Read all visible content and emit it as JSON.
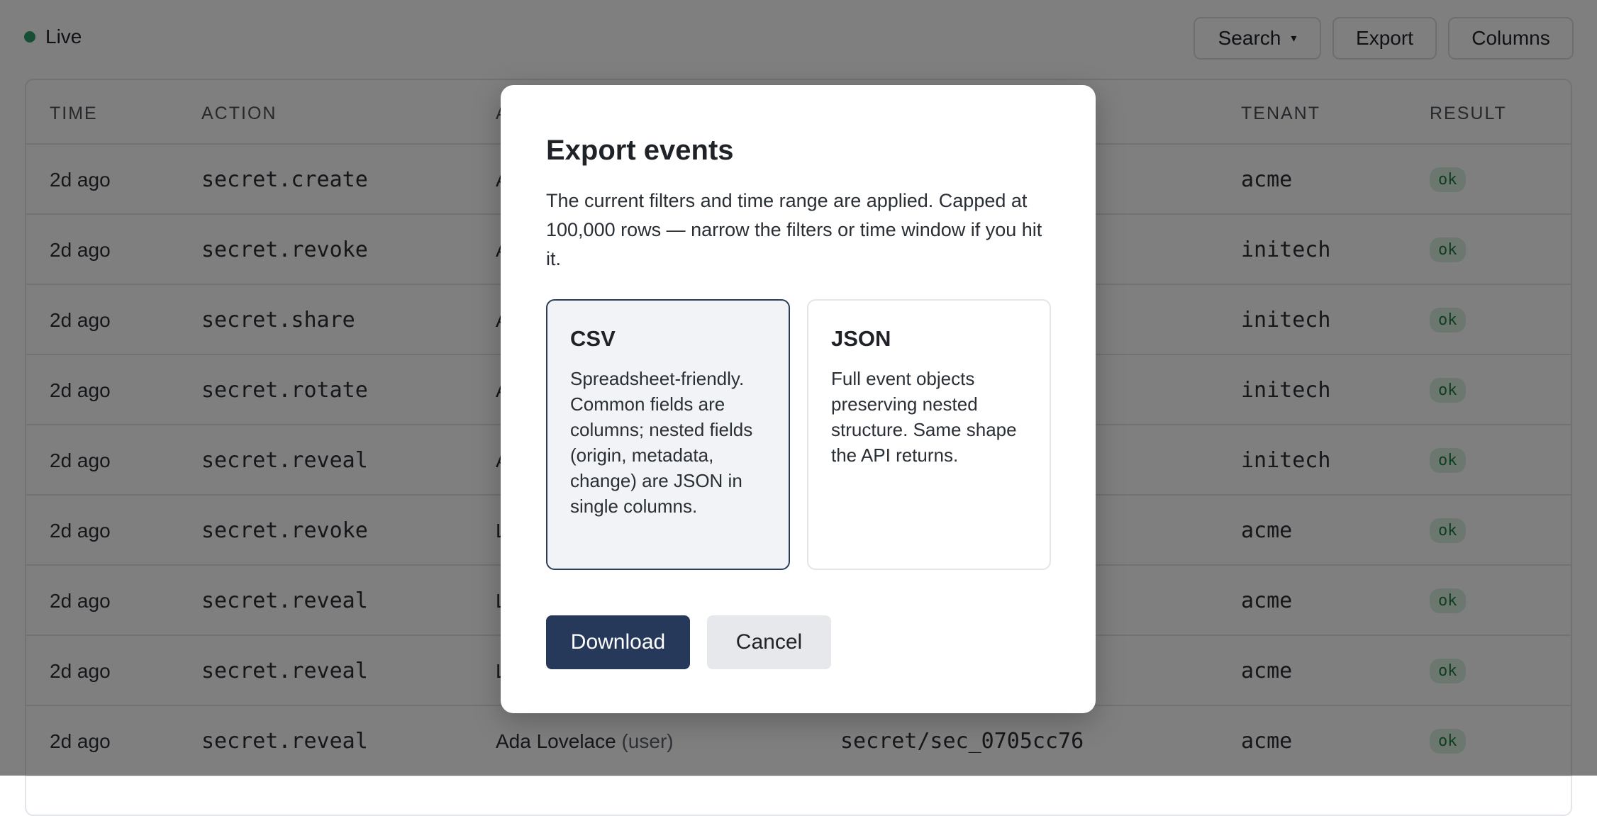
{
  "status": {
    "label": "Live",
    "color": "#2f9e6a"
  },
  "toolbar": {
    "search_label": "Search",
    "search_caret": "▾",
    "export_label": "Export",
    "columns_label": "Columns"
  },
  "table": {
    "columns": [
      "TIME",
      "ACTION",
      "A",
      "TENANT",
      "RESULT"
    ],
    "rows": [
      {
        "time": "2d ago",
        "action": "secret.create",
        "actor": "A",
        "resource": "",
        "tenant": "acme",
        "result": "ok"
      },
      {
        "time": "2d ago",
        "action": "secret.revoke",
        "actor": "A",
        "resource": "",
        "tenant": "initech",
        "result": "ok"
      },
      {
        "time": "2d ago",
        "action": "secret.share",
        "actor": "A",
        "resource": "",
        "tenant": "initech",
        "result": "ok"
      },
      {
        "time": "2d ago",
        "action": "secret.rotate",
        "actor": "A",
        "resource": "",
        "tenant": "initech",
        "result": "ok"
      },
      {
        "time": "2d ago",
        "action": "secret.reveal",
        "actor": "A",
        "resource": "",
        "tenant": "initech",
        "result": "ok"
      },
      {
        "time": "2d ago",
        "action": "secret.revoke",
        "actor": "L",
        "resource": "",
        "tenant": "acme",
        "result": "ok"
      },
      {
        "time": "2d ago",
        "action": "secret.reveal",
        "actor": "L",
        "resource": "",
        "tenant": "acme",
        "result": "ok"
      },
      {
        "time": "2d ago",
        "action": "secret.reveal",
        "actor": "L",
        "resource": "",
        "tenant": "acme",
        "result": "ok"
      },
      {
        "time": "2d ago",
        "action": "secret.reveal",
        "actor": "Ada Lovelace",
        "actor_kind": "(user)",
        "resource": "secret/sec_0705cc76",
        "tenant": "acme",
        "result": "ok"
      }
    ]
  },
  "modal": {
    "title": "Export events",
    "description": "The current filters and time range are applied. Capped at 100,000 rows — narrow the filters or time window if you hit it.",
    "options": [
      {
        "title": "CSV",
        "description": "Spreadsheet-friendly. Common fields are columns; nested fields (origin, metadata, change) are JSON in single columns.",
        "selected": true
      },
      {
        "title": "JSON",
        "description": "Full event objects preserving nested structure. Same shape the API returns.",
        "selected": false
      }
    ],
    "download_label": "Download",
    "cancel_label": "Cancel"
  },
  "colors": {
    "primary": "#26395a",
    "selected_border": "#2b3d57",
    "badge_bg": "#d9f0df",
    "badge_text": "#1e7a3d"
  }
}
